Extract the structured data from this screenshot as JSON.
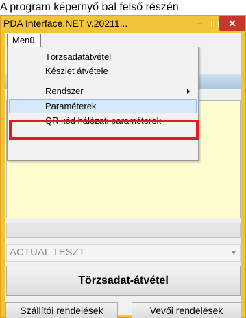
{
  "caption": "A program képernyő bal felső részén",
  "window": {
    "title": "PDA Interface.NET v.20211...",
    "minimize_glyph": "−",
    "close_glyph": "✕"
  },
  "menu": {
    "label": "Menü",
    "items": [
      {
        "label": "Törzsadatátvétel"
      },
      {
        "label": "Készlet átvétele"
      },
      {
        "label": "Rendszer",
        "has_submenu": true
      },
      {
        "label": "Paraméterek",
        "highlighted": true
      },
      {
        "label": "QR kód hálózati paraméterek"
      }
    ]
  },
  "form": {
    "combo_value": "ACTUAL TESZT",
    "main_button": "Törzsadat-átvétel",
    "supplier_orders_button": "Szállítói rendelések",
    "customer_orders_button": "Vevői rendelések"
  },
  "colors": {
    "frame": "#f2c43a",
    "close_button": "#c7352c",
    "panel": "#fffccf",
    "highlight": "#d6e7f8",
    "callout": "#e11b22"
  }
}
